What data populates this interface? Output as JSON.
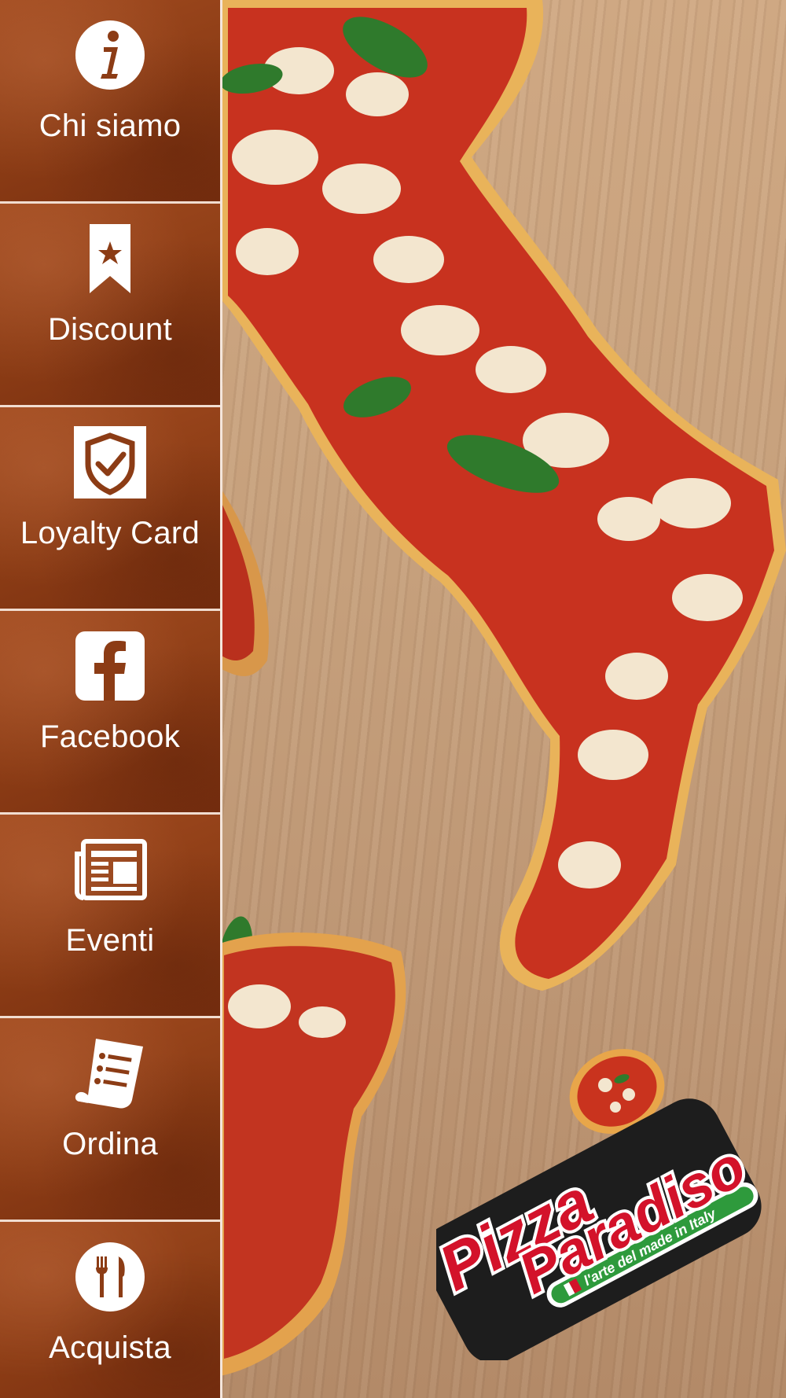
{
  "menu": {
    "items": [
      {
        "label": "Chi siamo",
        "icon": "info-icon"
      },
      {
        "label": "Discount",
        "icon": "bookmark-star-icon"
      },
      {
        "label": "Loyalty Card",
        "icon": "shield-check-icon"
      },
      {
        "label": "Facebook",
        "icon": "facebook-icon"
      },
      {
        "label": "Eventi",
        "icon": "newspaper-icon"
      },
      {
        "label": "Ordina",
        "icon": "order-list-icon"
      },
      {
        "label": "Acquista",
        "icon": "fork-knife-icon"
      }
    ]
  },
  "logo": {
    "line1": "Pizza",
    "line2": "Paradiso",
    "tagline": "l'arte del made in Italy"
  },
  "colors": {
    "sidebar": "#8c3c15",
    "logo_red": "#d3122a",
    "logo_green": "#2e9a3c"
  }
}
